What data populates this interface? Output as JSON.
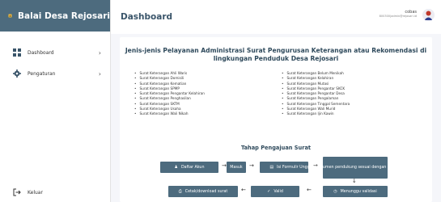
{
  "app": {
    "title": "Balai Desa Rejosari",
    "logo_icon": "village-emblem-icon"
  },
  "sidebar": {
    "items": [
      {
        "label": "Dashboard",
        "icon": "grid-icon"
      },
      {
        "label": "Pengaturan",
        "icon": "gear-icon"
      }
    ],
    "logout_label": "Keluar"
  },
  "header": {
    "page_title": "Dashboard",
    "user_name": "cobas",
    "user_email": "800300|admin@rejosari.id"
  },
  "main": {
    "title_line1": "Jenis-jenis Pelayanan Administrasi Surat Pengurusan Keterangan atau Rekomendasi di",
    "title_line2": "lingkungan Penduduk Desa Rejosari",
    "services_left": [
      "Surat Keterangan Ahli Waris",
      "Surat Keterangan Domisili",
      "Surat Keterangan Kematian",
      "Surat Keterangan SPMP",
      "Surat Keterangan Pengantar Kelahiran",
      "Surat Keterangan Penghasilan",
      "Surat Keterangan SKTM",
      "Surat Keterangan Usaha",
      "Surat Keterangan Wali Nikah"
    ],
    "services_right": [
      "Surat Keterangan Belum Menikah",
      "Surat Keterangan Kelahiran",
      "Surat Keterangan Mutasi",
      "Surat Keterangan Pengantar SKCK",
      "Surat Keterangan Pengantar Desa",
      "Surat Keterangan Pengalaman",
      "Surat Keterangan Tinggal Sementara",
      "Surat Keterangan Wali Murid",
      "Surat Keterangan Ijin Kawin"
    ],
    "flow_title": "Tahap Pengajuan Surat",
    "flow": {
      "daftar": "Daftar Akun",
      "masuk": "Masuk",
      "isi": "Isi Formulir",
      "unggah": "Unggah dokumen pendukung sesuai dengan persyaratan",
      "menunggu": "Menunggu validasi",
      "valid": "Valid",
      "cetak": "Cetak/download surat"
    }
  },
  "colors": {
    "brand": "#4d6b7e",
    "accent_text": "#2f4a5c"
  }
}
